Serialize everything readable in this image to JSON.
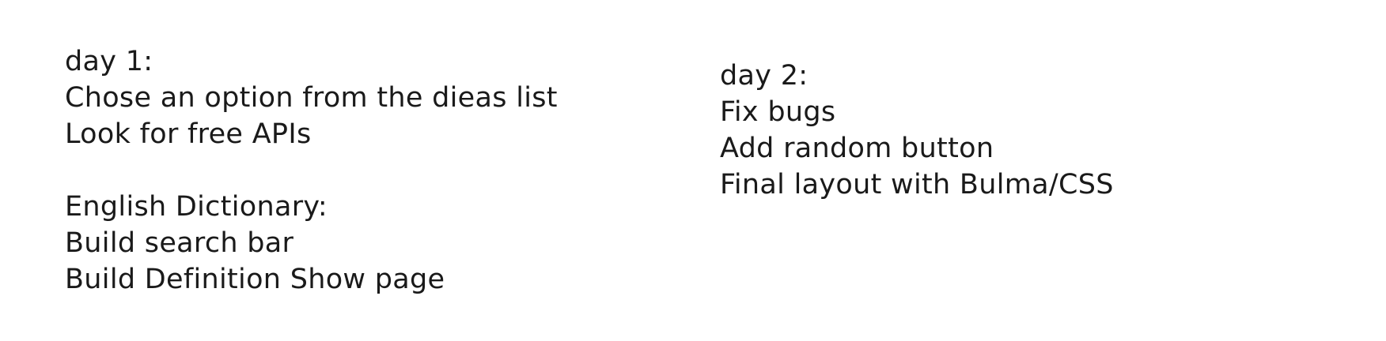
{
  "day1": {
    "heading": "day 1:",
    "lines": [
      "Chose an option from the dieas list",
      "Look for free APIs"
    ],
    "section": {
      "heading": "English Dictionary:",
      "lines": [
        "Build search bar",
        "Build Definition Show page"
      ]
    }
  },
  "day2": {
    "heading": "day 2:",
    "lines": [
      "Fix bugs",
      "Add random button",
      "Final layout with Bulma/CSS"
    ]
  },
  "colors": {
    "background": "#ffffff",
    "ink": "#1a1a1a"
  }
}
